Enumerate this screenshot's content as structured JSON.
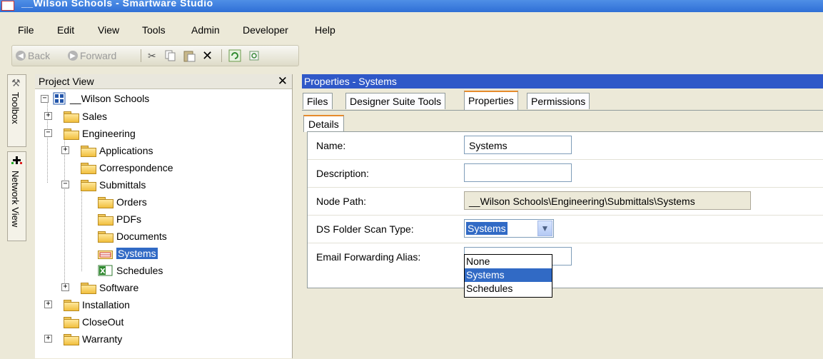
{
  "window": {
    "title": "__Wilson Schools - Smartware Studio"
  },
  "menubar": {
    "items": [
      "File",
      "Edit",
      "View",
      "Tools",
      "Admin",
      "Developer",
      "Help"
    ]
  },
  "toolbar": {
    "back": "Back",
    "forward": "Forward"
  },
  "sidetabs": {
    "toolbox": "Toolbox",
    "network": "Network View"
  },
  "project_view": {
    "title": "Project View",
    "close": "✕",
    "tree": [
      {
        "label": "__Wilson Schools",
        "icon": "network-node-icon"
      },
      {
        "label": "Sales",
        "icon": "folder-icon"
      },
      {
        "label": "Engineering",
        "icon": "folder-icon"
      },
      {
        "label": "Applications",
        "icon": "folder-icon"
      },
      {
        "label": "Correspondence",
        "icon": "folder-icon"
      },
      {
        "label": "Submittals",
        "icon": "folder-icon"
      },
      {
        "label": "Orders",
        "icon": "folder-icon"
      },
      {
        "label": "PDFs",
        "icon": "folder-icon"
      },
      {
        "label": "Documents",
        "icon": "folder-icon"
      },
      {
        "label": "Systems",
        "icon": "systems-folder-icon",
        "selected": true
      },
      {
        "label": "Schedules",
        "icon": "spreadsheet-icon"
      },
      {
        "label": "Software",
        "icon": "folder-icon"
      },
      {
        "label": "Installation",
        "icon": "folder-icon"
      },
      {
        "label": "CloseOut",
        "icon": "folder-icon"
      },
      {
        "label": "Warranty",
        "icon": "folder-icon"
      }
    ]
  },
  "properties": {
    "header": "Properties - Systems",
    "tabs": [
      "Files",
      "Designer Suite Tools",
      "Properties",
      "Permissions"
    ],
    "active_tab": "Properties",
    "subtab": "Details",
    "fields": {
      "name_label": "Name:",
      "name_value": "Systems",
      "description_label": "Description:",
      "description_value": "",
      "nodepath_label": "Node Path:",
      "nodepath_value": "__Wilson Schools\\Engineering\\Submittals\\Systems",
      "scantype_label": "DS Folder Scan Type:",
      "scantype_value": "Systems",
      "email_label": "Email Forwarding Alias:",
      "email_value": ""
    },
    "scantype_options": [
      "None",
      "Systems",
      "Schedules"
    ]
  },
  "colors": {
    "selection": "#316ac5",
    "header": "#2f58c8",
    "tab_accent": "#e68b2c"
  }
}
